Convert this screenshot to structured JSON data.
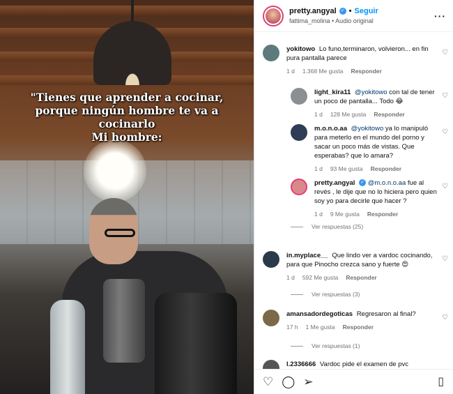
{
  "video": {
    "caption_lines": [
      "\"Tienes que aprender a cocinar,",
      "porque ningún hombre te va a",
      "cocinarlo",
      "Mi hombre:"
    ]
  },
  "post_header": {
    "username": "pretty.angyal",
    "separator": "•",
    "follow_label": "Seguir",
    "subtitle": "fattima_molina • Audio original",
    "more_icon": "more-options-icon"
  },
  "comments": [
    {
      "user": "yokitowo",
      "text": "Lo funo,terminaron, volvieron... en fin pura pantalla parece",
      "time": "1 d",
      "likes": "1.368 Me gusta",
      "reply": "Responder",
      "avatar_color": "#5d7a7c"
    },
    {
      "user": "light_kira11",
      "mention": "@yokitowo",
      "text": " con tal de tener un poco de pantalla... Todo 😂",
      "time": "1 d",
      "likes": "128 Me gusta",
      "reply": "Responder",
      "avatar_color": "#8b8f93"
    },
    {
      "user": "m.o.n.o.aa",
      "mention": "@yokitowo",
      "text": " ya lo manipuló para meterlo en el mundo del porno y sacar un poco más de vistas. Que esperabas? que lo amara?",
      "time": "1 d",
      "likes": "93 Me gusta",
      "reply": "Responder",
      "avatar_color": "#2f3d57"
    },
    {
      "user": "pretty.angyal",
      "mention": "@m.o.n.o.aa",
      "text": " fue al revés , le dije que no lo hiciera pero quien soy yo para decirle que hacer ?",
      "time": "1 d",
      "likes": "9 Me gusta",
      "reply": "Responder",
      "avatar_color": "#d88a8a"
    },
    {
      "user": "in.myplace__",
      "text": "Que lindo ver a vardoc cocinando, para que Pinocho crezca sano y fuerte 😍",
      "time": "1 d",
      "likes": "592 Me gusta",
      "reply": "Responder",
      "avatar_color": "#2b3a4a"
    },
    {
      "user": "amansadordegoticas",
      "text": "Regresaron al final?",
      "time": "17 h",
      "likes": "1 Me gusta",
      "reply": "Responder",
      "avatar_color": "#7a6a4a"
    },
    {
      "user": "l.2336666",
      "text": "Vardoc pide el examen de pvc",
      "avatar_color": "#555"
    }
  ],
  "view_replies": [
    "Ver respuestas (25)",
    "Ver respuestas (3)",
    "Ver respuestas (1)"
  ],
  "actions": {
    "like": "heart-icon",
    "comment": "comment-icon",
    "share": "share-icon",
    "save": "bookmark-icon"
  }
}
